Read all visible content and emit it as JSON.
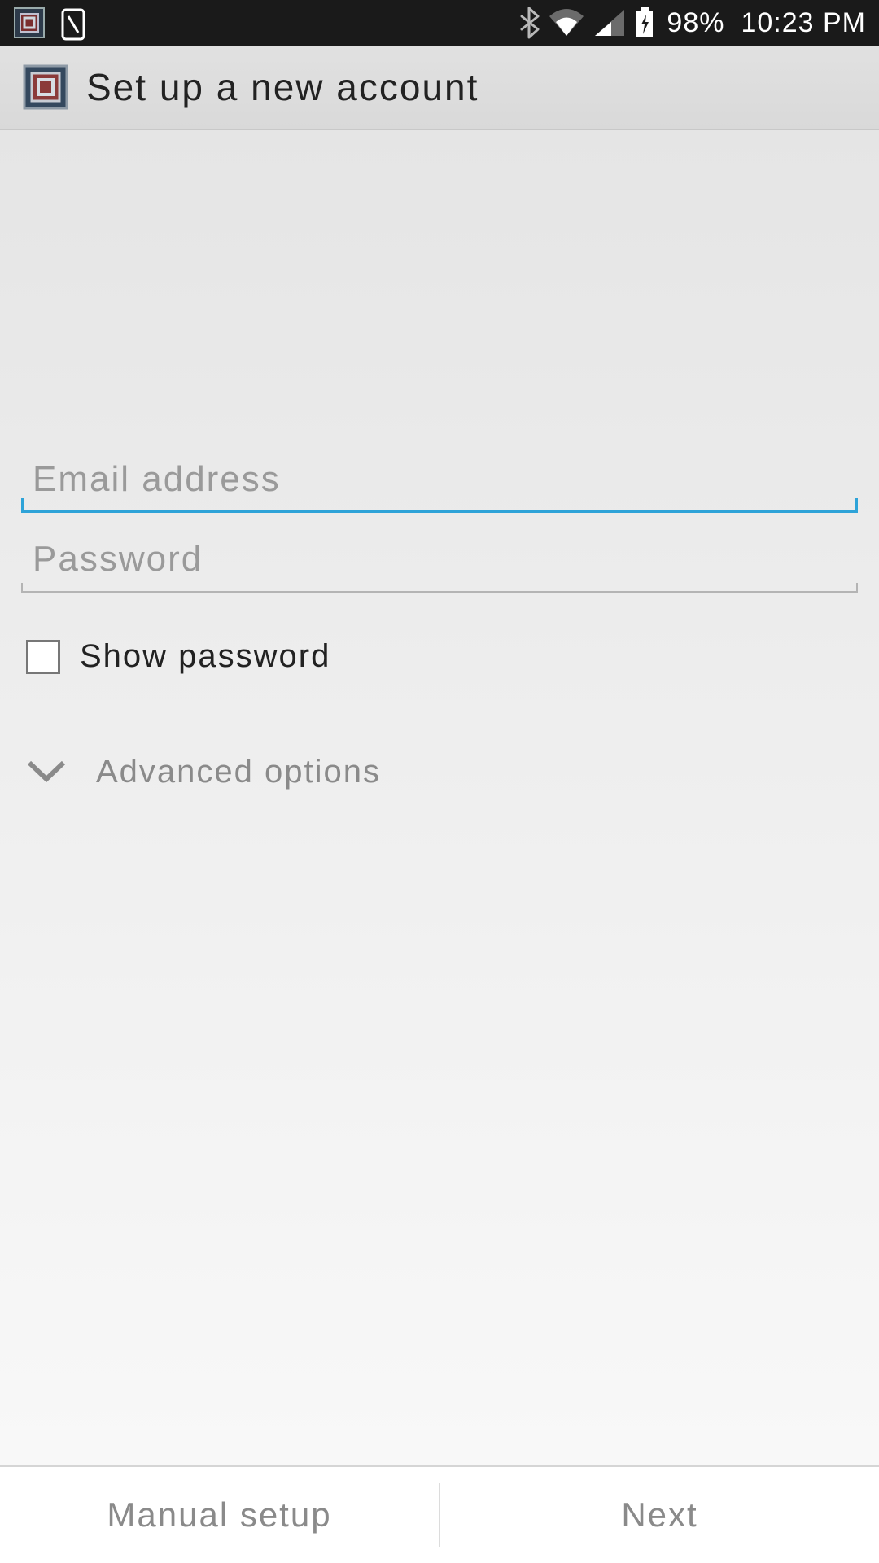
{
  "status_bar": {
    "battery_pct": "98%",
    "time": "10:23 PM"
  },
  "header": {
    "title": "Set up a new account"
  },
  "form": {
    "email_placeholder": "Email address",
    "password_placeholder": "Password",
    "show_password_label": "Show password",
    "advanced_label": "Advanced options"
  },
  "footer": {
    "manual_label": "Manual setup",
    "next_label": "Next"
  }
}
